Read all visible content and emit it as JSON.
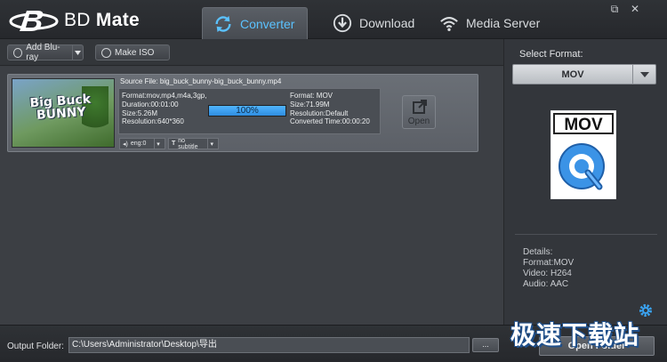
{
  "app": {
    "name_light": "BD ",
    "name_bold": "Mate"
  },
  "tabs": [
    {
      "label": "Converter",
      "icon": "refresh-icon",
      "active": true
    },
    {
      "label": "Download",
      "icon": "download-icon",
      "active": false
    },
    {
      "label": "Media Server",
      "icon": "wifi-icon",
      "active": false
    }
  ],
  "window_controls": {
    "restore": "⧉",
    "close": "✕"
  },
  "toolbar": {
    "add_bluray": "Add Blu-ray",
    "make_iso": "Make ISO"
  },
  "task": {
    "thumbnail_title_line1": "Big Buck",
    "thumbnail_title_line2": "BUNNY",
    "source_file": "Source File: big_buck_bunny-big_buck_bunny.mp4",
    "input": {
      "format": "Format:mov,mp4,m4a,3gp,",
      "duration": "Duration:00:01:00",
      "size": "Size:5.26M",
      "resolution": "Resolution:640*360"
    },
    "output": {
      "format": "Format: MOV",
      "size": "Size:71.99M",
      "resolution": "Resolution:Default",
      "converted_time": "Converted Time:00:00:20"
    },
    "progress": {
      "percent": 100,
      "label": "100%"
    },
    "open_label": "Open",
    "audio_track": "eng:0",
    "subtitle": "no subtitle"
  },
  "side": {
    "select_label": "Select Format:",
    "selected_format": "MOV",
    "format_icon_text": "MOV",
    "details": {
      "heading": "Details:",
      "format": "Format:MOV",
      "video": "Video: H264",
      "audio": "Audio: AAC"
    }
  },
  "footer": {
    "output_label": "Output Folder:",
    "output_path": "C:\\Users\\Administrator\\Desktop\\导出",
    "browse_label": "...",
    "open_folder_label": "Open Folder"
  },
  "watermark": "极速下载站",
  "colors": {
    "accent": "#5bc2ff",
    "progress": "#3b9cf0"
  }
}
